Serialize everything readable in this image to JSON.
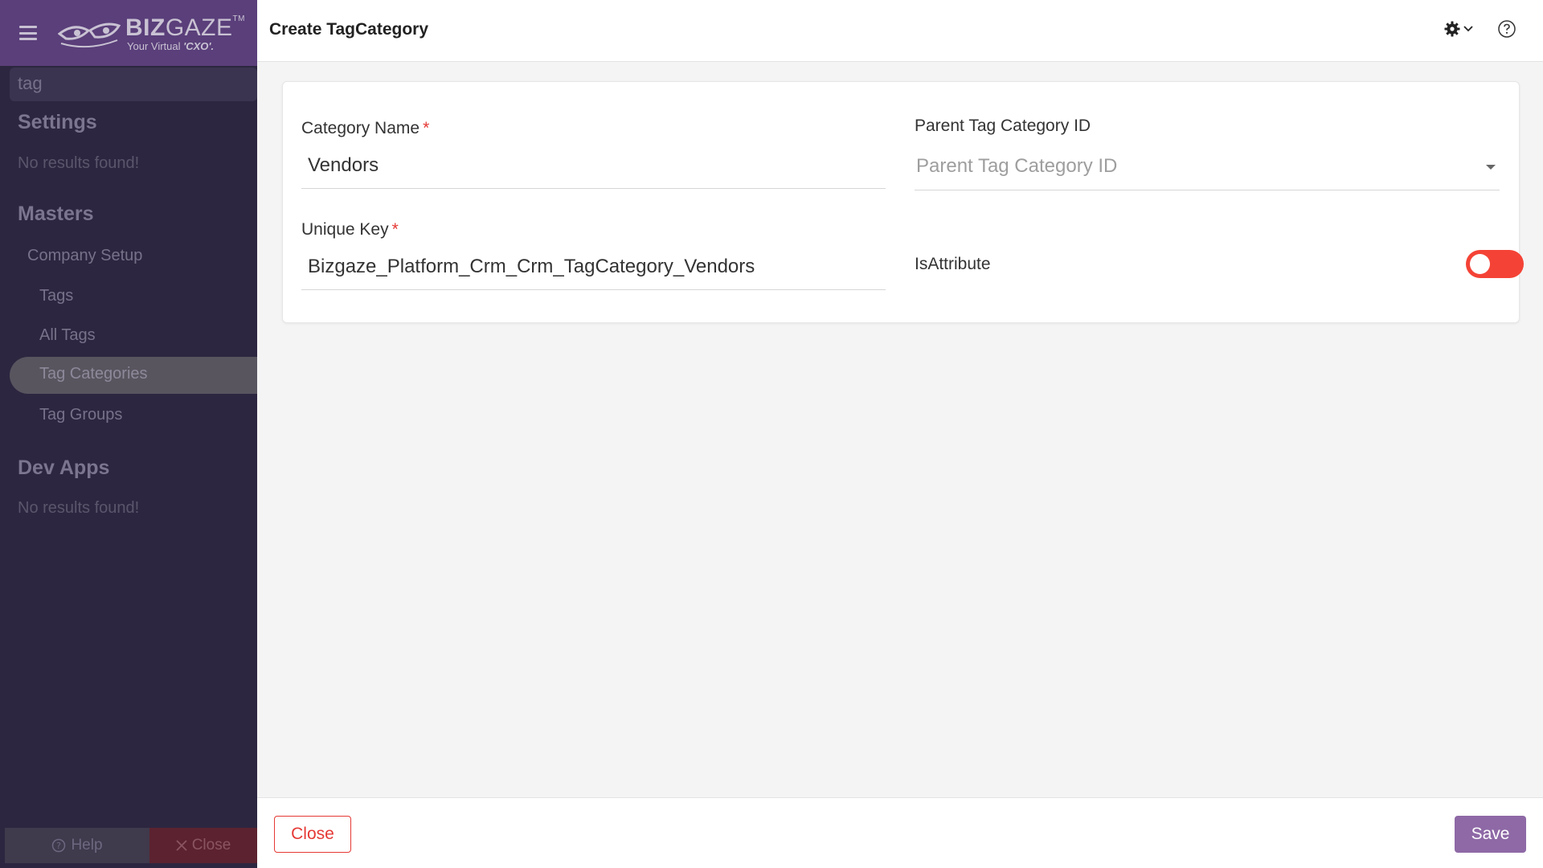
{
  "sidebar": {
    "logo": {
      "name_bold": "BIZ",
      "name_thin": "GAZE",
      "trademark": "TM",
      "tagline_prefix": "Your Virtual ",
      "tagline_emph": "'CXO'."
    },
    "search_value": "tag",
    "sections": [
      {
        "title": "Settings",
        "empty_text": "No results found!"
      },
      {
        "title": "Masters"
      },
      {
        "title": "Dev Apps",
        "empty_text": "No results found!"
      }
    ],
    "items": {
      "company_setup": "Company Setup",
      "tags": "Tags",
      "all_tags": "All Tags",
      "tag_categories": "Tag Categories",
      "tag_groups": "Tag Groups"
    },
    "footer": {
      "help_label": "Help",
      "close_label": "Close"
    }
  },
  "header": {
    "title": "Create TagCategory",
    "icons": [
      "gear-icon",
      "chevron-down-icon",
      "help-icon"
    ]
  },
  "form": {
    "category_name": {
      "label": "Category Name",
      "required_mark": "*",
      "value": "Vendors"
    },
    "parent_tag_category": {
      "label": "Parent Tag Category ID",
      "placeholder": "Parent Tag Category ID"
    },
    "unique_key": {
      "label": "Unique Key",
      "required_mark": "*",
      "value": "Bizgaze_Platform_Crm_Crm_TagCategory_Vendors"
    },
    "is_attribute": {
      "label": "IsAttribute",
      "checked": false
    }
  },
  "footer": {
    "close_label": "Close",
    "save_label": "Save"
  },
  "colors": {
    "accent": "#8e69a6",
    "danger": "#e53935",
    "toggle_off": "#f44336",
    "sidebar_bg": "#2d2640"
  }
}
